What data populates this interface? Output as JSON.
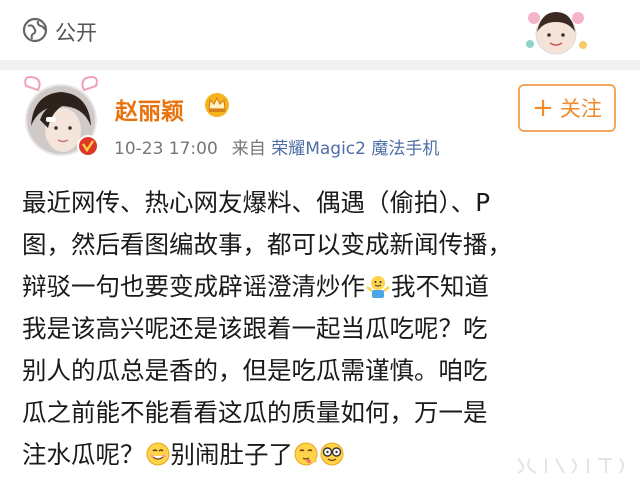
{
  "header": {
    "visibility_label": "公开",
    "visibility_icon": "globe-icon"
  },
  "post": {
    "author": "赵丽颖",
    "badge_icon": "crown-icon",
    "verified_icon": "verified-badge-icon",
    "timestamp": "10-23 17:00",
    "source_prefix": "来自",
    "device": "荣耀Magic2 魔法手机",
    "follow_label": "关注",
    "lines": [
      {
        "text": "最近网传、热心网友爆料、偶遇（偷拍）、P"
      },
      {
        "text": "图，然后看图编故事，都可以变成新闻传播，"
      },
      {
        "text_before": "辩驳一句也要变成辟谣澄清炒作",
        "emoji": "shrug-emoji-icon",
        "text_after": "我不知道"
      },
      {
        "text": "我是该高兴呢还是该跟着一起当瓜吃呢？吃"
      },
      {
        "text": "别人的瓜总是香的，但是吃瓜需谨慎。咱吃"
      },
      {
        "text": "瓜之前能不能看看这瓜的质量如何，万一是"
      },
      {
        "text_before": "注水瓜呢？",
        "emoji": "smile-emoji-icon",
        "text_middle": "别闹肚子了",
        "emoji2": "tease-emoji-icon",
        "emoji3": "nerd-glasses-emoji-icon"
      }
    ]
  },
  "colors": {
    "accent_orange": "#e8730c",
    "link_blue": "#4e6ea8",
    "verified_red": "#e0362c"
  }
}
